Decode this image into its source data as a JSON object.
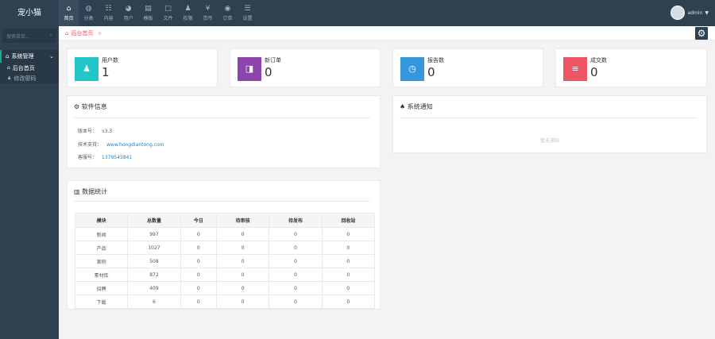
{
  "brand": "宠小猫",
  "nav": [
    {
      "label": "首页",
      "icon": "home-icon",
      "glyph": "⌂",
      "active": true
    },
    {
      "label": "分类",
      "icon": "globe-icon",
      "glyph": "◍",
      "active": false
    },
    {
      "label": "内容",
      "icon": "sitemap-icon",
      "glyph": "☷",
      "active": false
    },
    {
      "label": "用户",
      "icon": "user-circle-icon",
      "glyph": "◕",
      "active": false
    },
    {
      "label": "模板",
      "icon": "grid-icon",
      "glyph": "▤",
      "active": false
    },
    {
      "label": "文件",
      "icon": "file-icon",
      "glyph": "□",
      "active": false
    },
    {
      "label": "权限",
      "icon": "person-icon",
      "glyph": "♟",
      "active": false
    },
    {
      "label": "货币",
      "icon": "yen-icon",
      "glyph": "¥",
      "active": false
    },
    {
      "label": "订单",
      "icon": "eye-icon",
      "glyph": "◉",
      "active": false
    },
    {
      "label": "设置",
      "icon": "settings-icon",
      "glyph": "☰",
      "active": false
    }
  ],
  "user": {
    "name": "admin"
  },
  "sidebar": {
    "search_placeholder": "搜索菜单...",
    "group_label": "系统管理",
    "items": [
      {
        "label": "后台首页",
        "icon": "home-icon",
        "glyph": "⌂"
      },
      {
        "label": "修改密码",
        "icon": "user-icon",
        "glyph": "♟"
      }
    ]
  },
  "tab": {
    "label": "后台首页"
  },
  "stats": [
    {
      "label": "用户数",
      "value": "1",
      "color": "#23c6c8",
      "icon": "user-icon",
      "glyph": "♟"
    },
    {
      "label": "新订单",
      "value": "0",
      "color": "#8e44ad",
      "icon": "cart-icon",
      "glyph": "◨"
    },
    {
      "label": "报告数",
      "value": "0",
      "color": "#3498db",
      "icon": "clock-icon",
      "glyph": "◷"
    },
    {
      "label": "成交数",
      "value": "0",
      "color": "#ed5565",
      "icon": "layers-icon",
      "glyph": "≡"
    }
  ],
  "software": {
    "title": "软件信息",
    "rows": [
      {
        "key": "版本号：",
        "value": "v3.3"
      },
      {
        "key": "技术支持：",
        "value": "www.hongdiantong.com"
      },
      {
        "key": "客服号：",
        "value": "1379545841"
      }
    ]
  },
  "notice": {
    "title": "系统通知",
    "empty": "暂无通知"
  },
  "stats_table": {
    "title": "数据统计",
    "headers": [
      "模块",
      "总数量",
      "今日",
      "待审核",
      "待发布",
      "回收站"
    ],
    "rows": [
      [
        "新闻",
        "997",
        "0",
        "0",
        "0",
        "0"
      ],
      [
        "产品",
        "1027",
        "0",
        "0",
        "0",
        "0"
      ],
      [
        "案例",
        "508",
        "0",
        "0",
        "0",
        "0"
      ],
      [
        "素材库",
        "872",
        "0",
        "0",
        "0",
        "0"
      ],
      [
        "招聘",
        "409",
        "0",
        "0",
        "0",
        "0"
      ],
      [
        "下载",
        "6",
        "0",
        "0",
        "0",
        "0"
      ]
    ]
  }
}
